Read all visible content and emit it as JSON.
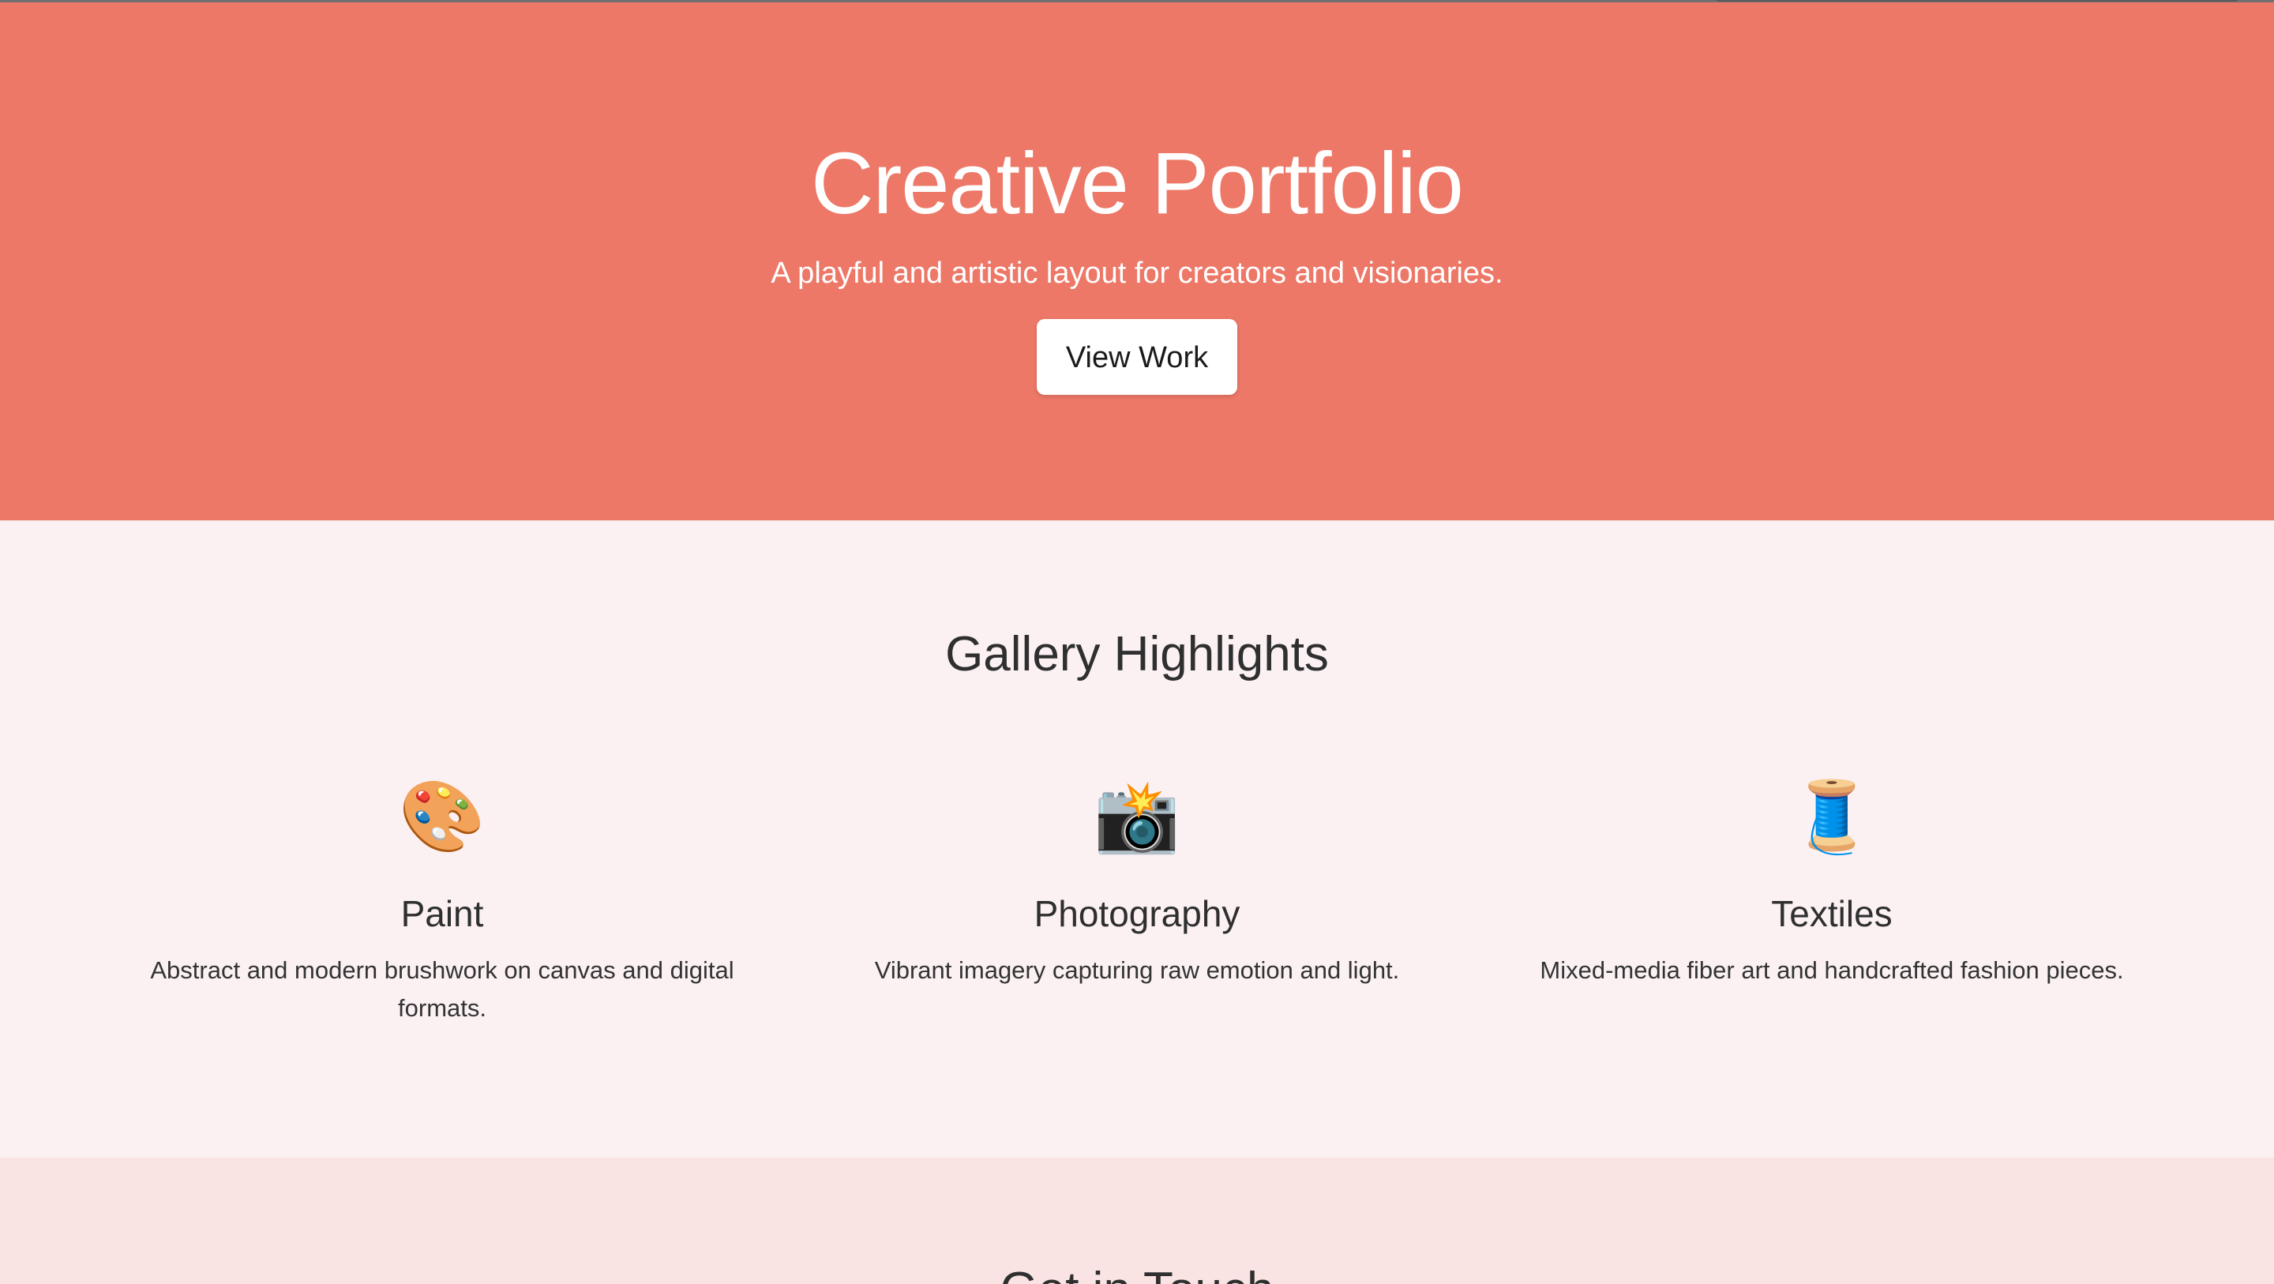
{
  "hero": {
    "title": "Creative Portfolio",
    "subtitle": "A playful and artistic layout for creators and visionaries.",
    "button_label": "View Work",
    "background": "#ed7867"
  },
  "gallery": {
    "title": "Gallery Highlights",
    "items": [
      {
        "icon": "🎨",
        "icon_name": "palette-icon",
        "title": "Paint",
        "text": "Abstract and modern brushwork on canvas and digital formats."
      },
      {
        "icon": "📸",
        "icon_name": "camera-flash-icon",
        "title": "Photography",
        "text": "Vibrant imagery capturing raw emotion and light."
      },
      {
        "icon": "🧵",
        "icon_name": "thread-spool-icon",
        "title": "Textiles",
        "text": "Mixed-media fiber art and handcrafted fashion pieces."
      }
    ]
  },
  "contact": {
    "title": "Get in Touch"
  }
}
